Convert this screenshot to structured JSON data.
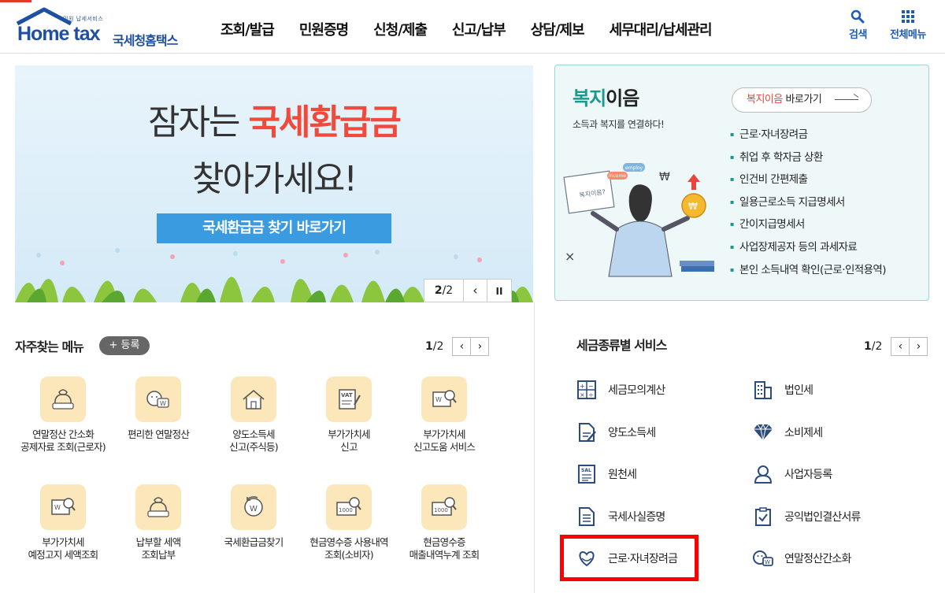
{
  "header": {
    "logo": {
      "tagline": "민원 납세서비스",
      "brand": "Home tax",
      "name": "국세청홈택스"
    },
    "nav": [
      "조회/발급",
      "민원증명",
      "신청/제출",
      "신고/납부",
      "상담/제보",
      "세무대리/납세관리"
    ],
    "search_label": "검색",
    "allmenu_label": "전체메뉴"
  },
  "banner": {
    "line1_pre": "잠자는 ",
    "line1_highlight": "국세환급금",
    "line2": "찾아가세요!",
    "button": "국세환급금 찾기 바로가기",
    "page_current": "2",
    "page_total": "/2",
    "prev_icon": "‹",
    "pause_icon": "II"
  },
  "welfare": {
    "title_a": "복지",
    "title_b": "이음",
    "subtitle": "소득과 복지를 연결하다!",
    "link_a": "복지이음",
    "link_b": " 바로가기",
    "items": [
      "근로·자녀장려금",
      "취업 후 학자금 상환",
      "인건비 간편제출",
      "일용근로소득 지급명세서",
      "간이지급명세서",
      "사업장제공자 등의 과세자료",
      "본인 소득내역 확인(근로·인적용역)"
    ],
    "illus_texts": {
      "card": "복지이음?",
      "tag1": "employ",
      "tag2": "income"
    }
  },
  "favorites": {
    "title": "자주찾는 메뉴",
    "register": "+ 등록",
    "page_current": "1",
    "page_total": "/2",
    "items": [
      {
        "label": "연말정산 간소화\n공제자료 조회(근로자)",
        "icon": "money-bag-icon"
      },
      {
        "label": "편리한 연말정산",
        "icon": "coin-face-icon"
      },
      {
        "label": "양도소득세\n신고(주식등)",
        "icon": "house-icon"
      },
      {
        "label": "부가가치세\n신고",
        "icon": "vat-doc-icon"
      },
      {
        "label": "부가가치세\n신고도움 서비스",
        "icon": "doc-search-icon"
      },
      {
        "label": "부가가치세\n예정고지 세액조회",
        "icon": "doc-search-icon"
      },
      {
        "label": "납부할 세액\n조회납부",
        "icon": "money-bag-icon"
      },
      {
        "label": "국세환급금찾기",
        "icon": "refund-coin-icon"
      },
      {
        "label": "현금영수증 사용내역\n조회(소비자)",
        "icon": "receipt-search-icon"
      },
      {
        "label": "현금영수증\n매출내역누계 조회",
        "icon": "receipt-search-icon"
      }
    ]
  },
  "tax_service": {
    "title": "세금종류별 서비스",
    "page_current": "1",
    "page_total": "/2",
    "left": [
      "세금모의계산",
      "양도소득세",
      "원천세",
      "국세사실증명",
      "근로·자녀장려금"
    ],
    "right": [
      "법인세",
      "소비제세",
      "사업자등록",
      "공익법인결산서류",
      "연말정산간소화"
    ]
  },
  "colors": {
    "brand_blue": "#1e4fa3",
    "highlight_red": "#ff0000",
    "banner_red": "#ef4a3c",
    "welfare_green": "#1a9a8a",
    "fav_icon_bg": "#fbe7b9"
  }
}
